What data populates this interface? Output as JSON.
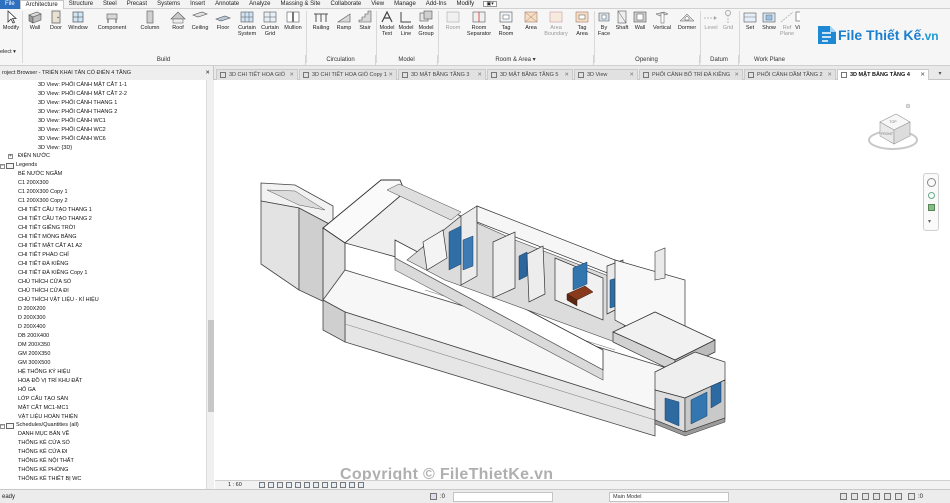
{
  "menubar": {
    "file": "File",
    "items": [
      "Architecture",
      "Structure",
      "Steel",
      "Precast",
      "Systems",
      "Insert",
      "Annotate",
      "Analyze",
      "Massing & Site",
      "Collaborate",
      "View",
      "Manage",
      "Add-Ins",
      "Modify"
    ],
    "active": "Architecture"
  },
  "ribbon": {
    "modify": "Modify",
    "select": "elect ▾",
    "buttons": {
      "wall": "Wall",
      "door": "Door",
      "window": "Window",
      "component": "Component",
      "column": "Column",
      "roof": "Roof",
      "ceiling": "Ceiling",
      "floor": "Floor",
      "curtain_system": "Curtain System",
      "curtain_grid": "Curtain Grid",
      "mullion": "Mullion",
      "railing": "Railing",
      "ramp": "Ramp",
      "stair": "Stair",
      "model_text": "Model Text",
      "model_line": "Model Line",
      "model_group": "Model Group",
      "room": "Room",
      "room_separator": "Room Separator",
      "tag_room": "Tag Room",
      "area": "Area",
      "area_boundary": "Area Boundary",
      "tag_area": "Tag Area",
      "by_face": "By Face",
      "shaft": "Shaft",
      "wall_opening": "Wall",
      "vertical": "Vertical",
      "dormer": "Dormer",
      "level": "Level",
      "grid": "Grid",
      "set": "Set",
      "show": "Show",
      "ref_plane": "Ref Plane",
      "viewer": "View"
    },
    "panels": {
      "build": "Build",
      "circulation": "Circulation",
      "model": "Model",
      "room_area": "Room & Area ▾",
      "opening": "Opening",
      "datum": "Datum",
      "work_plane": "Work Plane"
    }
  },
  "logo": {
    "brand": "File",
    "tail": "Thiết Kế",
    "suffix": ".vn"
  },
  "browser": {
    "title": "roject Browser - TRIỂN KHAI TÂN CỔ ĐIỂN 4 TẦNG",
    "views": [
      "3D View: PHỐI CẢNH MẶT CẮT 1-1",
      "3D View: PHỐI CẢNH MẶT CẮT 2-2",
      "3D View: PHỐI CẢNH THANG 1",
      "3D View: PHỐI CẢNH THANG 2",
      "3D View: PHỐI CẢNH WC1",
      "3D View: PHỐI CẢNH WC2",
      "3D View: PHỐI CẢNH WC6",
      "3D View: {3D}"
    ],
    "dien_nuoc": "ĐIỆN NƯỚC",
    "legends_header": "Legends",
    "legends": [
      "BỂ NƯỚC NGẦM",
      "C1 200X300",
      "C1 200X300 Copy 1",
      "C1 200X300 Copy 2",
      "CHI TIẾT CẦU TẠO THANG 1",
      "CHI TIẾT CẦU TẠO THANG 2",
      "CHI TIẾT GIẾNG TRỜI",
      "CHI TIẾT MÓNG BĂNG",
      "CHI TIẾT MẶT CẮT A1 A2",
      "CHI TIẾT PHÀO CHỈ",
      "CHI TIẾT ĐÀ KIỀNG",
      "CHI TIẾT ĐÀ KIỀNG Copy 1",
      "CHÚ THÍCH CỬA SỔ",
      "CHÚ THÍCH CỬA ĐI",
      "CHÚ THÍCH VẬT LIỆU - KÍ HIỆU",
      "D 200X200",
      "D 200X300",
      "D 200X400",
      "DB 200X400",
      "DM 200X350",
      "GM 200X350",
      "GM 300X500",
      "HỆ THỐNG KÝ HIỆU",
      "HOẠ ĐỒ VỊ TRÍ KHU ĐẤT",
      "HỐ GA",
      "LỚP CẤU TẠO SÀN",
      "MẶT CẮT MC1-MC1",
      "VẬT LIỆU HOÀN THIỆN"
    ],
    "schedules_header": "Schedules/Quantities (all)",
    "schedules": [
      "DANH MỤC BẢN VẼ",
      "THỐNG KÊ CỬA SỔ",
      "THỐNG KÊ CỬA ĐI",
      "THỐNG KÊ NỘI THẤT",
      "THỐNG KÊ PHÒNG",
      "THỐNG KÊ THIẾT BỊ WC"
    ]
  },
  "tabs": [
    "3D CHI TIẾT HOA GIÓ",
    "3D CHI TIẾT HOA GIÓ Copy 1",
    "3D MẶT BẰNG TẦNG 3",
    "3D MẶT BẰNG TẦNG 5",
    "3D View",
    "PHỐI CẢNH BỐ TRÍ ĐÀ KIỀNG",
    "PHỐI CẢNH DẦM TẦNG 2",
    "3D MẶT BẰNG TẦNG 4"
  ],
  "active_tab": "3D MẶT BẰNG TẦNG 4",
  "viewbar": {
    "scale": "1 : 60"
  },
  "status": {
    "left": "eady",
    "model": "Main Model",
    "zero": ":0"
  },
  "watermark": "Copyright © FileThietKe.vn",
  "viewcube": {
    "top": "TOP",
    "front": "FRONT"
  }
}
